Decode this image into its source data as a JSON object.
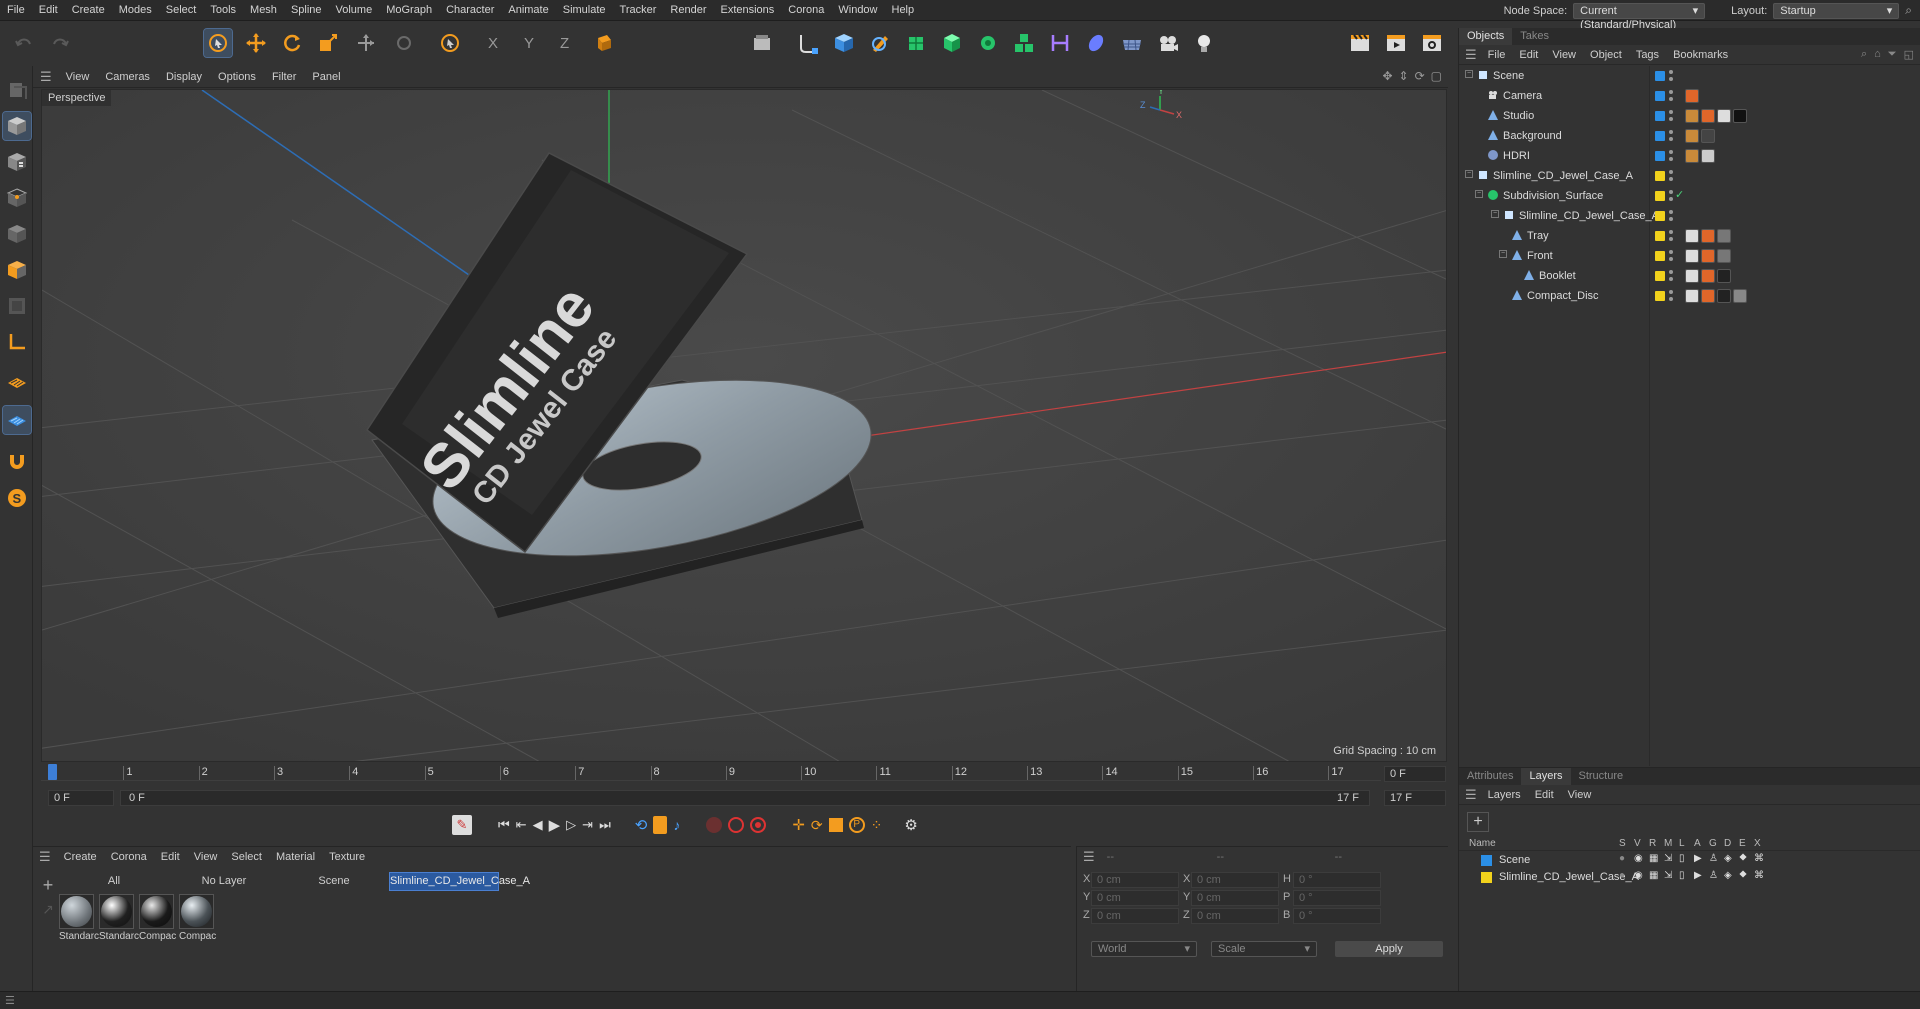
{
  "menubar": {
    "items": [
      "File",
      "Edit",
      "Create",
      "Modes",
      "Select",
      "Tools",
      "Mesh",
      "Spline",
      "Volume",
      "MoGraph",
      "Character",
      "Animate",
      "Simulate",
      "Tracker",
      "Render",
      "Extensions",
      "Corona",
      "Window",
      "Help"
    ],
    "node_space_label": "Node Space:",
    "node_space_value": "Current (Standard/Physical)",
    "layout_label": "Layout:",
    "layout_value": "Startup"
  },
  "viewport": {
    "menu": [
      "View",
      "Cameras",
      "Display",
      "Options",
      "Filter",
      "Panel"
    ],
    "label": "Perspective",
    "grid_spacing": "Grid Spacing : 10 cm",
    "case_title": "Slimline",
    "case_subtitle": "CD Jewel Case"
  },
  "timeline": {
    "ticks": [
      "0",
      "1",
      "2",
      "3",
      "4",
      "5",
      "6",
      "7",
      "8",
      "9",
      "10",
      "11",
      "12",
      "13",
      "14",
      "15",
      "16",
      "17"
    ],
    "current_frame_field": "0 F",
    "start_field": "0 F",
    "range_start": "0 F",
    "range_end": "17 F",
    "end_field": "17 F"
  },
  "materials": {
    "menu": [
      "Create",
      "Corona",
      "Edit",
      "View",
      "Select",
      "Material",
      "Texture"
    ],
    "filters": [
      "All",
      "No Layer",
      "Scene",
      "Slimline_CD_Jewel_Case_A"
    ],
    "items": [
      "Standarc",
      "Standarc",
      "Compac",
      "Compac"
    ]
  },
  "coords": {
    "header": [
      "--",
      "--",
      "--"
    ],
    "rows": [
      {
        "a": "X",
        "av": "0 cm",
        "b": "X",
        "bv": "0 cm",
        "c": "H",
        "cv": "0 °"
      },
      {
        "a": "Y",
        "av": "0 cm",
        "b": "Y",
        "bv": "0 cm",
        "c": "P",
        "cv": "0 °"
      },
      {
        "a": "Z",
        "av": "0 cm",
        "b": "Z",
        "bv": "0 cm",
        "c": "B",
        "cv": "0 °"
      }
    ],
    "space": "World",
    "mode": "Scale",
    "apply": "Apply"
  },
  "objects_panel": {
    "tabs": [
      "Objects",
      "Takes"
    ],
    "menu": [
      "File",
      "Edit",
      "View",
      "Object",
      "Tags",
      "Bookmarks"
    ],
    "items": [
      {
        "name": "Scene",
        "color": "#2b8fe6"
      },
      {
        "name": "Camera",
        "color": "#2b8fe6"
      },
      {
        "name": "Studio",
        "color": "#2b8fe6"
      },
      {
        "name": "Background",
        "color": "#2b8fe6"
      },
      {
        "name": "HDRI",
        "color": "#2b8fe6"
      },
      {
        "name": "Slimline_CD_Jewel_Case_A",
        "color": "#f2d21c"
      },
      {
        "name": "Subdivision_Surface",
        "color": "#f2d21c"
      },
      {
        "name": "Slimline_CD_Jewel_Case_A",
        "color": "#f2d21c"
      },
      {
        "name": "Tray",
        "color": "#f2d21c"
      },
      {
        "name": "Front",
        "color": "#f2d21c"
      },
      {
        "name": "Booklet",
        "color": "#f2d21c"
      },
      {
        "name": "Compact_Disc",
        "color": "#f2d21c"
      }
    ]
  },
  "layers_panel": {
    "tabs": [
      "Attributes",
      "Layers",
      "Structure"
    ],
    "menu": [
      "Layers",
      "Edit",
      "View"
    ],
    "columns": [
      "Name",
      "S",
      "V",
      "R",
      "M",
      "L",
      "A",
      "G",
      "D",
      "E",
      "X"
    ],
    "items": [
      {
        "name": "Scene",
        "color": "#2b8fe6"
      },
      {
        "name": "Slimline_CD_Jewel_Case_A",
        "color": "#f2d21c"
      }
    ]
  }
}
